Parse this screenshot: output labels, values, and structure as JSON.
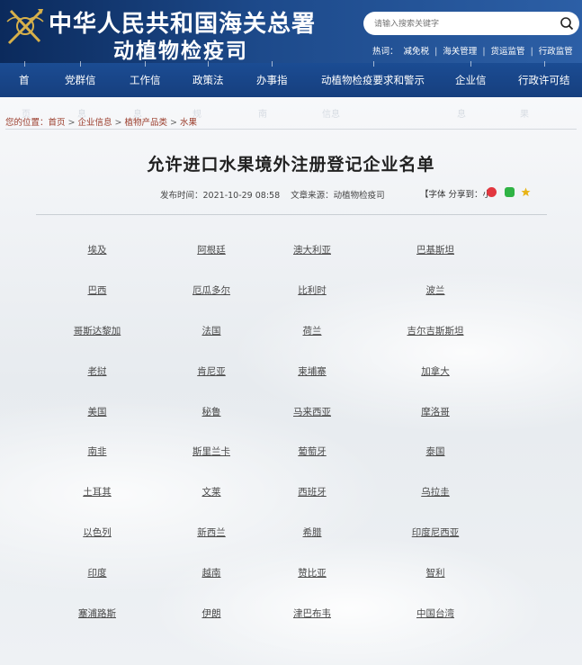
{
  "header": {
    "title": "中华人民共和国海关总署",
    "subtitle": "动植物检疫司"
  },
  "search": {
    "placeholder": "请输入搜索关键字"
  },
  "hot": {
    "label": "热词：",
    "items": [
      "减免税",
      "海关管理",
      "货运监管",
      "行政监管"
    ]
  },
  "nav": {
    "items": [
      "首",
      "党群信",
      "工作信",
      "政策法",
      "办事指",
      "动植物检疫要求和警示",
      "企业信",
      "行政许可结"
    ],
    "overflow": [
      "页",
      "息",
      "息",
      "规",
      "南",
      "信息",
      "息",
      "果"
    ]
  },
  "breadcrumb": {
    "prefix": "您的位置：",
    "items": [
      "首页",
      "企业信息",
      "植物产品类",
      "水果"
    ]
  },
  "article": {
    "title": "允许进口水果境外注册登记企业名单",
    "published_label": "发布时间：",
    "published": "2021-10-29 08:58",
    "source_label": "文章来源：",
    "source": "动植物检疫司",
    "font_label": "【字体",
    "share_label": "分享到：",
    "font_size_glyph": "小"
  },
  "countries": [
    [
      "埃及",
      "阿根廷",
      "澳大利亚",
      "巴基斯坦"
    ],
    [
      "巴西",
      "厄瓜多尔",
      "比利时",
      "波兰"
    ],
    [
      "哥斯达黎加",
      "法国",
      "荷兰",
      "吉尔吉斯斯坦"
    ],
    [
      "老挝",
      "肯尼亚",
      "柬埔寨",
      "加拿大"
    ],
    [
      "美国",
      "秘鲁",
      "马来西亚",
      "摩洛哥"
    ],
    [
      "南非",
      "斯里兰卡",
      "葡萄牙",
      "泰国"
    ],
    [
      "土耳其",
      "文莱",
      "西班牙",
      "乌拉圭"
    ],
    [
      "以色列",
      "新西兰",
      "希腊",
      "印度尼西亚"
    ],
    [
      "印度",
      "越南",
      "赞比亚",
      "智利"
    ],
    [
      "塞浦路斯",
      "伊朗",
      "津巴布韦",
      "中国台湾"
    ]
  ],
  "colors": {
    "header_bg": "#1d4a8b",
    "nav_bg": "#163f7e",
    "breadcrumb": "#9a3b2a"
  }
}
